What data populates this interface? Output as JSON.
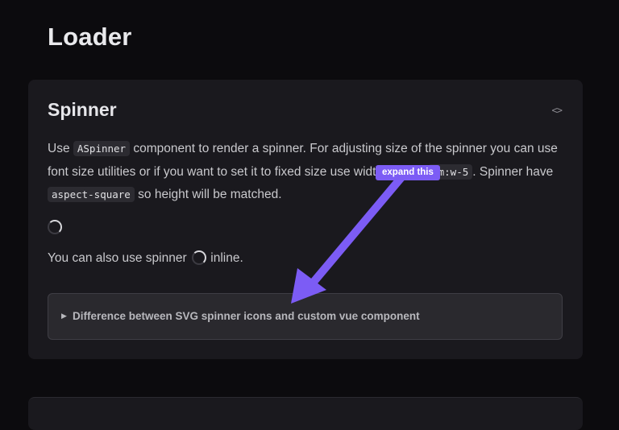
{
  "page": {
    "title": "Loader"
  },
  "card": {
    "title": "Spinner",
    "code_toggle": "<>",
    "desc": {
      "p1": "Use ",
      "code1": "ASpinner",
      "p2": " component to render a spinner. For adjusting size of the spinner you can use font size utilities or if you want to set it to fixed size use width utilities ",
      "code2": "em:w-5",
      "p3": ". Spinner have ",
      "code3": "aspect-square",
      "p4": " so height will be matched."
    },
    "inline_before": "You can also use spinner ",
    "inline_after": " inline.",
    "details_arrow": "▶",
    "details_label": "Difference between SVG spinner icons and custom vue component"
  },
  "annotation": {
    "tooltip": "expand this",
    "color": "#7c5cf5"
  },
  "colors": {
    "background": "#0c0b0e",
    "card": "#1a191e",
    "accent": "#7c5cf5"
  }
}
